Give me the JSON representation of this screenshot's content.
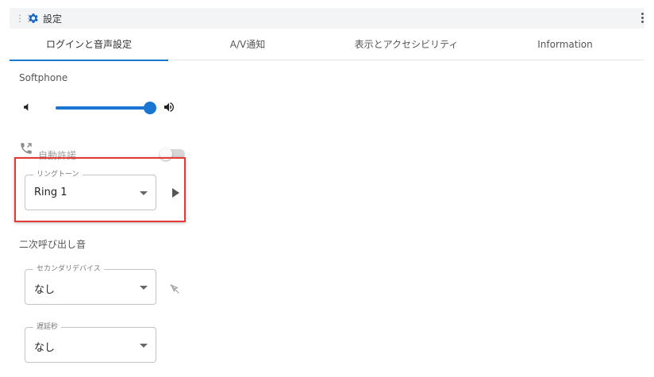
{
  "window": {
    "title": "設定"
  },
  "tabs": [
    {
      "label": "ログインと音声設定",
      "active": true
    },
    {
      "label": "A/V通知",
      "active": false
    },
    {
      "label": "表示とアクセシビリティ",
      "active": false
    },
    {
      "label": "Information",
      "active": false
    }
  ],
  "softphone": {
    "label": "Softphone",
    "volume_percent": 100,
    "auto_answer": {
      "label": "自動許諾",
      "enabled": false
    },
    "ringtone": {
      "legend": "リングトーン",
      "value": "Ring 1"
    }
  },
  "secondary_ring": {
    "label": "二次呼び出し音",
    "device": {
      "legend": "セカンダリデバイス",
      "value": "なし"
    },
    "delay": {
      "legend": "遅延秒",
      "value": "なし"
    }
  },
  "colors": {
    "accent": "#1976d2",
    "highlight": "#e53935"
  },
  "icons": [
    "drag-handle-icon",
    "gear-icon",
    "kebab-menu-icon",
    "volume-low-icon",
    "volume-high-icon",
    "phone-icon",
    "play-icon",
    "cursor-off-icon"
  ]
}
